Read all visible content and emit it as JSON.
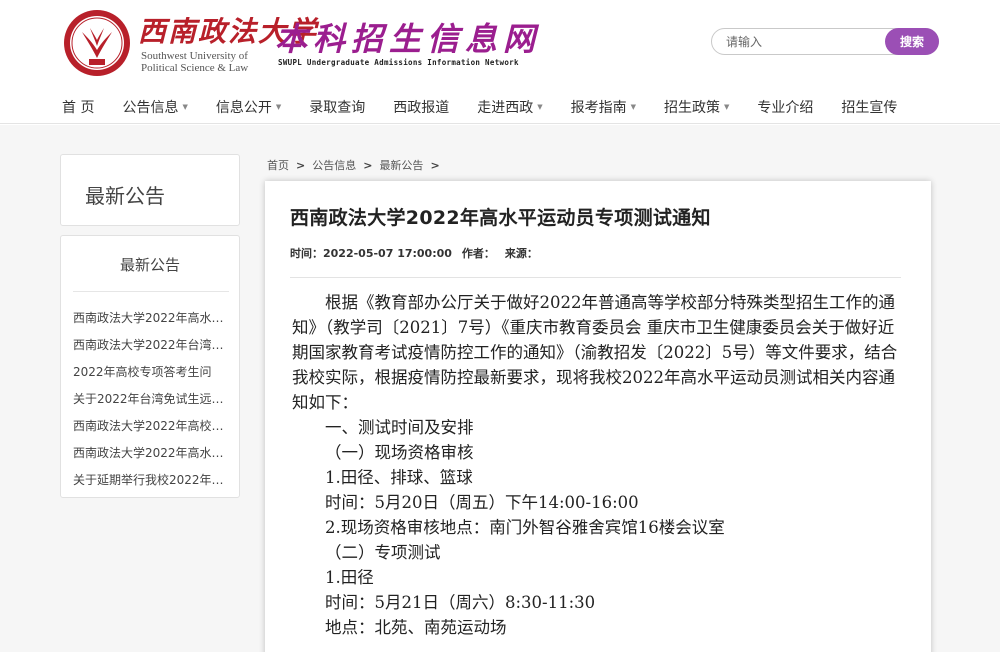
{
  "header": {
    "university_cn": "西南政法大学",
    "university_en_line1": "Southwest University of",
    "university_en_line2": "Political Science & Law",
    "site_title": "本科招生信息网",
    "site_subtitle": "SWUPL Undergraduate Admissions Information Network",
    "search_placeholder": "请输入",
    "search_button": "搜索"
  },
  "nav": {
    "items": [
      {
        "label": "首 页",
        "dropdown": false
      },
      {
        "label": "公告信息",
        "dropdown": true
      },
      {
        "label": "信息公开",
        "dropdown": true
      },
      {
        "label": "录取查询",
        "dropdown": false
      },
      {
        "label": "西政报道",
        "dropdown": false
      },
      {
        "label": "走进西政",
        "dropdown": true
      },
      {
        "label": "报考指南",
        "dropdown": true
      },
      {
        "label": "招生政策",
        "dropdown": true
      },
      {
        "label": "专业介绍",
        "dropdown": false
      },
      {
        "label": "招生宣传",
        "dropdown": false
      }
    ]
  },
  "sidebar": {
    "section_title": "最新公告",
    "list_heading": "最新公告",
    "items": [
      "西南政法大学2022年高水…",
      "西南政法大学2022年台湾…",
      "2022年高校专项答考生问",
      "关于2022年台湾免试生远…",
      "西南政法大学2022年高校…",
      "西南政法大学2022年高水…",
      "关于延期举行我校2022年…"
    ]
  },
  "breadcrumb": [
    "首页",
    "公告信息",
    "最新公告"
  ],
  "breadcrumb_sep": ">",
  "article": {
    "title": "西南政法大学2022年高水平运动员专项测试通知",
    "time_label": "时间：2022-05-07 17:00:00",
    "author_label": "作者：",
    "source_label": "来源：",
    "paragraphs": [
      "根据《教育部办公厅关于做好2022年普通高等学校部分特殊类型招生工作的通知》（教学司〔2021〕7号）《重庆市教育委员会 重庆市卫生健康委员会关于做好近期国家教育考试疫情防控工作的通知》（渝教招发〔2022〕5号）等文件要求，结合我校实际，根据疫情防控最新要求，现将我校2022年高水平运动员测试相关内容通知如下："
    ],
    "lines": [
      "一、测试时间及安排",
      "（一）现场资格审核",
      "1.田径、排球、篮球",
      "时间：5月20日（周五）下午14:00-16:00",
      "2.现场资格审核地点：南门外智谷雅舍宾馆16楼会议室",
      "（二）专项测试",
      "1.田径",
      "时间：5月21日（周六）8:30-11:30",
      "地点：北苑、南苑运动场"
    ]
  },
  "colors": {
    "brand_red": "#b8202a",
    "brand_purple": "#9b1e8f",
    "search_button": "#9b4fb5"
  }
}
